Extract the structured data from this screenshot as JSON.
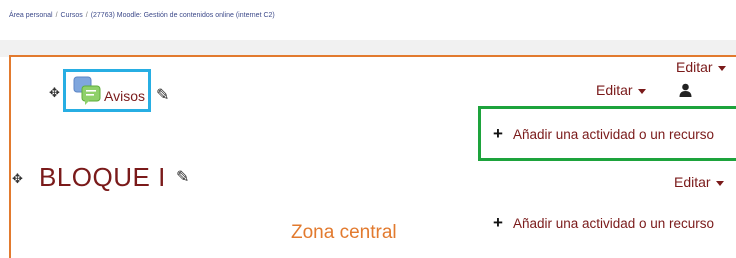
{
  "breadcrumb": [
    "Área personal",
    "Cursos",
    "(27763) Moodle: Gestión de contenidos online (internet C2)"
  ],
  "editar_label": "Editar",
  "avisos": {
    "label": "Avisos",
    "icon": "forum-icon"
  },
  "section": {
    "title": "BLOQUE I"
  },
  "add_activity_label": "Añadir una actividad o un recurso",
  "zone_label": "Zona central",
  "colors": {
    "accent_orange": "#e27a2e",
    "highlight_blue": "#27aee3",
    "highlight_green": "#1da33c",
    "link_maroon": "#7a1a1a"
  }
}
